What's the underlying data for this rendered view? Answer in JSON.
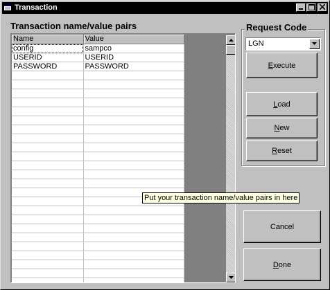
{
  "window": {
    "title": "Transaction",
    "icon": "app-window-icon",
    "controls": [
      "minimize-icon",
      "maximize-icon",
      "close-icon"
    ]
  },
  "pairs": {
    "heading": "Transaction name/value pairs",
    "columns": [
      "Name",
      "Value"
    ],
    "rows": [
      [
        "config",
        "sampco"
      ],
      [
        "USERID",
        "USERID"
      ],
      [
        "PASSWORD",
        "PASSWORD"
      ],
      [
        "",
        ""
      ],
      [
        "",
        ""
      ],
      [
        "",
        ""
      ],
      [
        "",
        ""
      ],
      [
        "",
        ""
      ],
      [
        "",
        ""
      ],
      [
        "",
        ""
      ],
      [
        "",
        ""
      ],
      [
        "",
        ""
      ],
      [
        "",
        ""
      ],
      [
        "",
        ""
      ],
      [
        "",
        ""
      ],
      [
        "",
        ""
      ],
      [
        "",
        ""
      ],
      [
        "",
        ""
      ],
      [
        "",
        ""
      ],
      [
        "",
        ""
      ],
      [
        "",
        ""
      ],
      [
        "",
        ""
      ],
      [
        "",
        ""
      ],
      [
        "",
        ""
      ],
      [
        "",
        ""
      ],
      [
        "",
        ""
      ],
      [
        "",
        ""
      ]
    ]
  },
  "request": {
    "label": "Request Code",
    "selected": "LGN",
    "execute": "Execute",
    "load": "Load",
    "new": "New",
    "reset": "Reset"
  },
  "actions": {
    "cancel": "Cancel",
    "done": "Done"
  },
  "tooltip": "Put your transaction name/value pairs in here"
}
